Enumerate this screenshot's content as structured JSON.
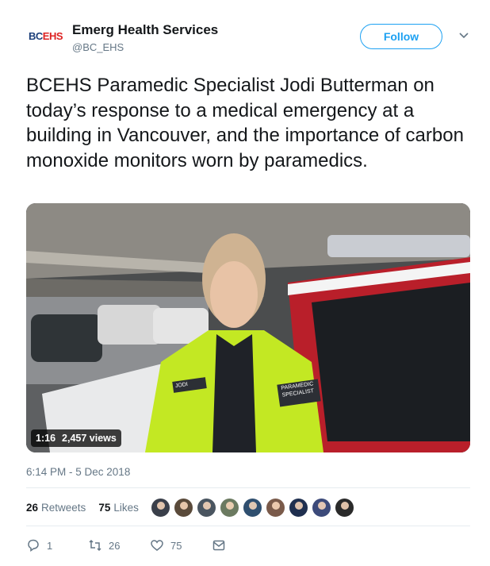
{
  "account": {
    "logo_text_1": "BC",
    "logo_text_2": "EHS",
    "name": "Emerg Health Services",
    "handle": "@BC_EHS"
  },
  "follow_label": "Follow",
  "tweet": {
    "text": "BCEHS Paramedic Specialist Jodi Butterman on today’s response to a medical emergency at a building in Vancouver, and the importance of carbon monoxide monitors worn by paramedics.",
    "timestamp": "6:14 PM - 5 Dec 2018"
  },
  "video": {
    "duration": "1:16",
    "views": "2,457 views",
    "patch_name": "JODI",
    "patch_role_1": "PARAMEDIC",
    "patch_role_2": "SPECIALIST"
  },
  "stats": {
    "retweets_count": "26",
    "retweets_label": "Retweets",
    "likes_count": "75",
    "likes_label": "Likes"
  },
  "avatar_colors": [
    "#3a3f4a",
    "#5a4a3a",
    "#4a5560",
    "#6b7a60",
    "#2f4f6f",
    "#7a5a4a",
    "#1f2f4f",
    "#3c4a7a",
    "#2a2a2a"
  ],
  "actions": {
    "reply_count": "1",
    "retweet_count": "26",
    "like_count": "75"
  },
  "colors": {
    "accent": "#1da1f2",
    "muted": "#657786",
    "text": "#14171a"
  }
}
